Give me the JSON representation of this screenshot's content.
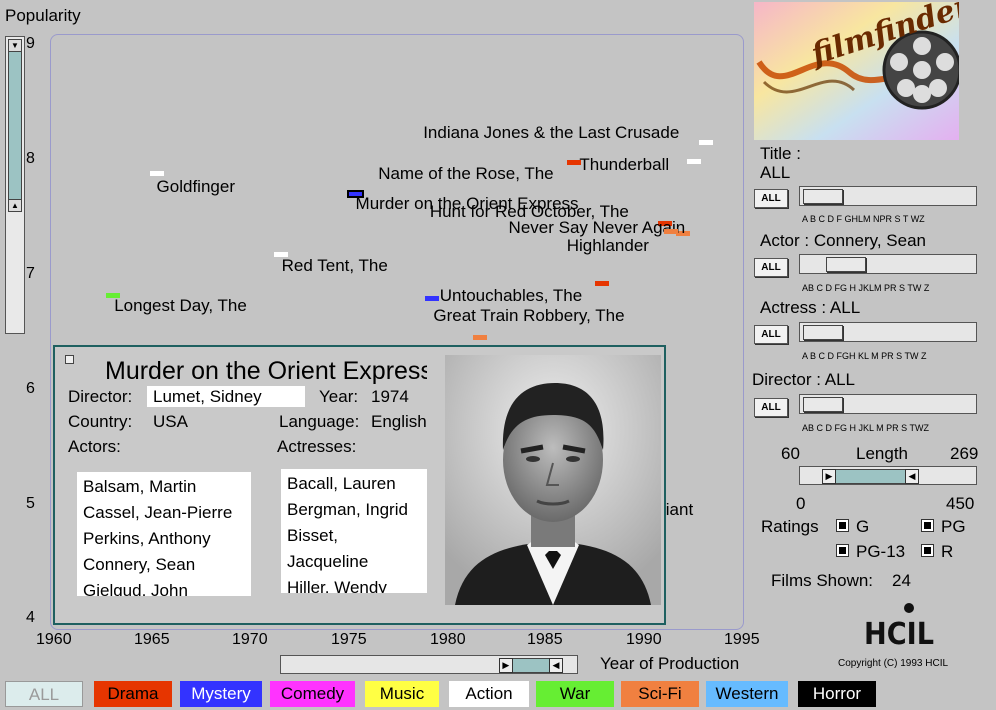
{
  "plot": {
    "y_axis_label": "Popularity",
    "x_axis_label": "Year of Production",
    "y_ticks": [
      "9",
      "8",
      "7",
      "6",
      "5",
      "4"
    ],
    "x_ticks": [
      "1960",
      "1965",
      "1970",
      "1975",
      "1980",
      "1985",
      "1990",
      "1995"
    ],
    "films": [
      {
        "title": "Goldfinger",
        "year": 1964.8,
        "popularity": 7.88,
        "genre": "Action",
        "color": "#ffffff"
      },
      {
        "title": "Name of the Rose, The",
        "year": 1986.0,
        "popularity": 7.98,
        "genre": "Drama",
        "color": "#e63500"
      },
      {
        "title": "Murder on the Orient Express",
        "year": 1974.8,
        "popularity": 7.72,
        "genre": "Mystery",
        "color": "#3333ff",
        "selected": true
      },
      {
        "title": "Indiana Jones & the Last Crusade",
        "year": 1992.7,
        "popularity": 8.15,
        "genre": "Action",
        "color": "#ffffff"
      },
      {
        "title": "Thunderball",
        "year": 1992.1,
        "popularity": 7.99,
        "genre": "Action",
        "color": "#ffffff"
      },
      {
        "title": "Hunt for Red October, The",
        "year": 1990.6,
        "popularity": 7.45,
        "genre": "Drama",
        "color": "#e63500"
      },
      {
        "title": "Never Say Never Again",
        "year": 1991.5,
        "popularity": 7.36,
        "genre": "Sci-Fi",
        "color": "#f08040"
      },
      {
        "title": "Highlander",
        "year": 1990.9,
        "popularity": 7.38,
        "genre": "Sci-Fi",
        "color": "#f08040"
      },
      {
        "title": "Red Tent, The",
        "year": 1971.1,
        "popularity": 7.18,
        "genre": "Action",
        "color": "#ffffff"
      },
      {
        "title": "Untouchables, The",
        "year": 1987.4,
        "popularity": 6.92,
        "genre": "Drama",
        "color": "#e63500"
      },
      {
        "title": "Longest Day, The",
        "year": 1962.6,
        "popularity": 6.82,
        "genre": "War",
        "color": "#66ee33"
      },
      {
        "title": "Great Train Robbery, The",
        "year": 1978.8,
        "popularity": 6.79,
        "genre": "Mystery",
        "color": "#3333ff"
      },
      {
        "title": "",
        "year": 1981.2,
        "popularity": 6.45,
        "genre": "Sci-Fi",
        "color": "#f08040"
      }
    ],
    "partial_label": "liant",
    "year_range": {
      "min_fraction": 0.77,
      "max_fraction": 1.0
    }
  },
  "popup": {
    "title": "Murder on the Orient Express",
    "director_label": "Director:",
    "director": "Lumet, Sidney",
    "year_label": "Year:",
    "year": "1974",
    "country_label": "Country:",
    "country": "USA",
    "language_label": "Language:",
    "language": "English",
    "actors_label": "Actors:",
    "actresses_label": "Actresses:",
    "actors": [
      "Balsam, Martin",
      "Cassel, Jean-Pierre",
      "Perkins, Anthony",
      "Connery, Sean",
      "Gielgud, John"
    ],
    "actresses": [
      "Bacall, Lauren",
      "Bergman, Ingrid",
      "Bisset, Jacqueline",
      "Hiller, Wendy"
    ]
  },
  "panel": {
    "logo_text": "filmfinder",
    "title_label": "Title :",
    "title_value": "ALL",
    "actor_label": "Actor : Connery, Sean",
    "actress_label": "Actress : ALL",
    "director_label": "Director : ALL",
    "all_button": "ALL",
    "alpha_title": "A B C D F GHLM NPR S  T  WZ",
    "alpha_actor": "AB  C  D FG H JKLM  PR S  TW Z",
    "alpha_actress": "A B  C  D FGH KL M  PR S  TW Z",
    "alpha_director": "AB  C  D FG H JKL M  PR S  TWZ",
    "length_label": "Length",
    "length_min": "60",
    "length_max": "269",
    "length_scale_min": "0",
    "length_scale_max": "450",
    "ratings_label": "Ratings",
    "ratings": [
      {
        "label": "G",
        "checked": true
      },
      {
        "label": "PG",
        "checked": true
      },
      {
        "label": "PG-13",
        "checked": true
      },
      {
        "label": "R",
        "checked": true
      }
    ],
    "films_shown_label": "Films Shown:",
    "films_shown": "24",
    "hcil_logo": "HCIL",
    "copyright": "Copyright (C) 1993 HCIL"
  },
  "genres": [
    {
      "label": "ALL",
      "bg": "#dcecec",
      "fg": "#9a9a9a"
    },
    {
      "label": "Drama",
      "bg": "#e63500",
      "fg": "#000000"
    },
    {
      "label": "Mystery",
      "bg": "#3333ff",
      "fg": "#ffffff"
    },
    {
      "label": "Comedy",
      "bg": "#ff33ff",
      "fg": "#000000"
    },
    {
      "label": "Music",
      "bg": "#ffff44",
      "fg": "#000000"
    },
    {
      "label": "Action",
      "bg": "#ffffff",
      "fg": "#000000"
    },
    {
      "label": "War",
      "bg": "#66ee33",
      "fg": "#000000"
    },
    {
      "label": "Sci-Fi",
      "bg": "#f08040",
      "fg": "#000000"
    },
    {
      "label": "Western",
      "bg": "#66bbff",
      "fg": "#000000"
    },
    {
      "label": "Horror",
      "bg": "#000000",
      "fg": "#ffffff"
    }
  ]
}
